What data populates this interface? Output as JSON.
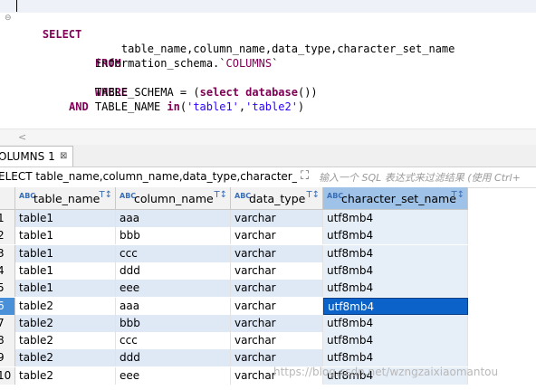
{
  "editor": {
    "lines": {
      "select": "SELECT",
      "columns": "table_name,column_name,data_type,character_set_name",
      "from": "FROM",
      "source_prefix": "information_schema.`",
      "source_table": "COLUMNS",
      "source_suffix": "`",
      "where": "WHERE",
      "cond1_left": "TABLE_SCHEMA = (",
      "cond1_kw": "select database",
      "cond1_right": "())",
      "and": "AND",
      "cond2_left": "TABLE_NAME ",
      "cond2_kw": "in",
      "cond2_open": "(",
      "cond2_v1": "'table1'",
      "cond2_comma": ",",
      "cond2_v2": "'table2'",
      "cond2_close": ")"
    }
  },
  "results_tab": {
    "label": "OLUMNS 1",
    "close_glyph": "⊠"
  },
  "filter": {
    "sql_text": "ELECT table_name,column_name,data_type,character_set_name",
    "placeholder": "输入一个 SQL 表达式来过滤结果 (使用 Ctrl+"
  },
  "grid": {
    "columns": [
      "table_name",
      "column_name",
      "data_type",
      "character_set_name"
    ],
    "type_badge": "ABC",
    "sort_glyph": "T↕",
    "selected_column": "character_set_name",
    "rows": [
      {
        "n": "1",
        "table_name": "table1",
        "column_name": "aaa",
        "data_type": "varchar",
        "character_set_name": "utf8mb4"
      },
      {
        "n": "2",
        "table_name": "table1",
        "column_name": "bbb",
        "data_type": "varchar",
        "character_set_name": "utf8mb4"
      },
      {
        "n": "3",
        "table_name": "table1",
        "column_name": "ccc",
        "data_type": "varchar",
        "character_set_name": "utf8mb4"
      },
      {
        "n": "4",
        "table_name": "table1",
        "column_name": "ddd",
        "data_type": "varchar",
        "character_set_name": "utf8mb4"
      },
      {
        "n": "5",
        "table_name": "table1",
        "column_name": "eee",
        "data_type": "varchar",
        "character_set_name": "utf8mb4"
      },
      {
        "n": "6",
        "table_name": "table2",
        "column_name": "aaa",
        "data_type": "varchar",
        "character_set_name": "utf8mb4"
      },
      {
        "n": "7",
        "table_name": "table2",
        "column_name": "bbb",
        "data_type": "varchar",
        "character_set_name": "utf8mb4"
      },
      {
        "n": "8",
        "table_name": "table2",
        "column_name": "ccc",
        "data_type": "varchar",
        "character_set_name": "utf8mb4"
      },
      {
        "n": "9",
        "table_name": "table2",
        "column_name": "ddd",
        "data_type": "varchar",
        "character_set_name": "utf8mb4"
      },
      {
        "n": "10",
        "table_name": "table2",
        "column_name": "eee",
        "data_type": "varchar",
        "character_set_name": "utf8mb4"
      }
    ],
    "active_row": "6"
  },
  "watermark": "https://blog.csdn.net/wzngzaixiaomantou",
  "colors": {
    "keyword": "#7f0055",
    "string": "#2a00ff",
    "row_alt": "#dfe8f5",
    "selection": "#0b62c9"
  }
}
